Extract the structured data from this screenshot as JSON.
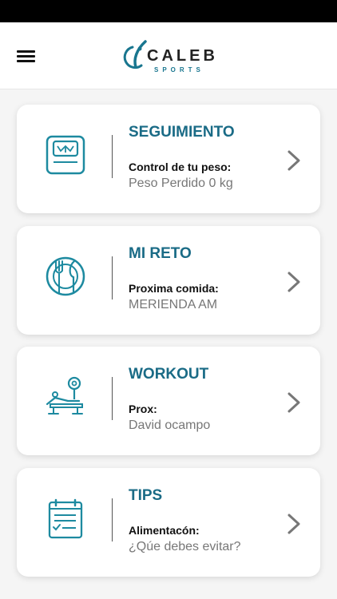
{
  "header": {
    "brand_name": "CALEB",
    "brand_sub": "SPORTS",
    "menu_icon": "hamburger-menu-icon"
  },
  "colors": {
    "accent": "#1a6b86",
    "icon_teal": "#1d8aa0",
    "status_bar": "#000000"
  },
  "cards": [
    {
      "title": "SEGUIMIENTO",
      "label": "Control de tu peso:",
      "value": "Peso Perdido 0 kg",
      "icon": "weight-scale-icon"
    },
    {
      "title": "MI RETO",
      "label": "Proxima comida:",
      "value": "MERIENDA AM",
      "icon": "plate-cutlery-icon"
    },
    {
      "title": "WORKOUT",
      "label": "Prox:",
      "value": "David ocampo",
      "icon": "bench-press-icon"
    },
    {
      "title": "TIPS",
      "label": "Alimentacón:",
      "value": "¿Qúe debes evitar?",
      "icon": "checklist-icon"
    }
  ]
}
